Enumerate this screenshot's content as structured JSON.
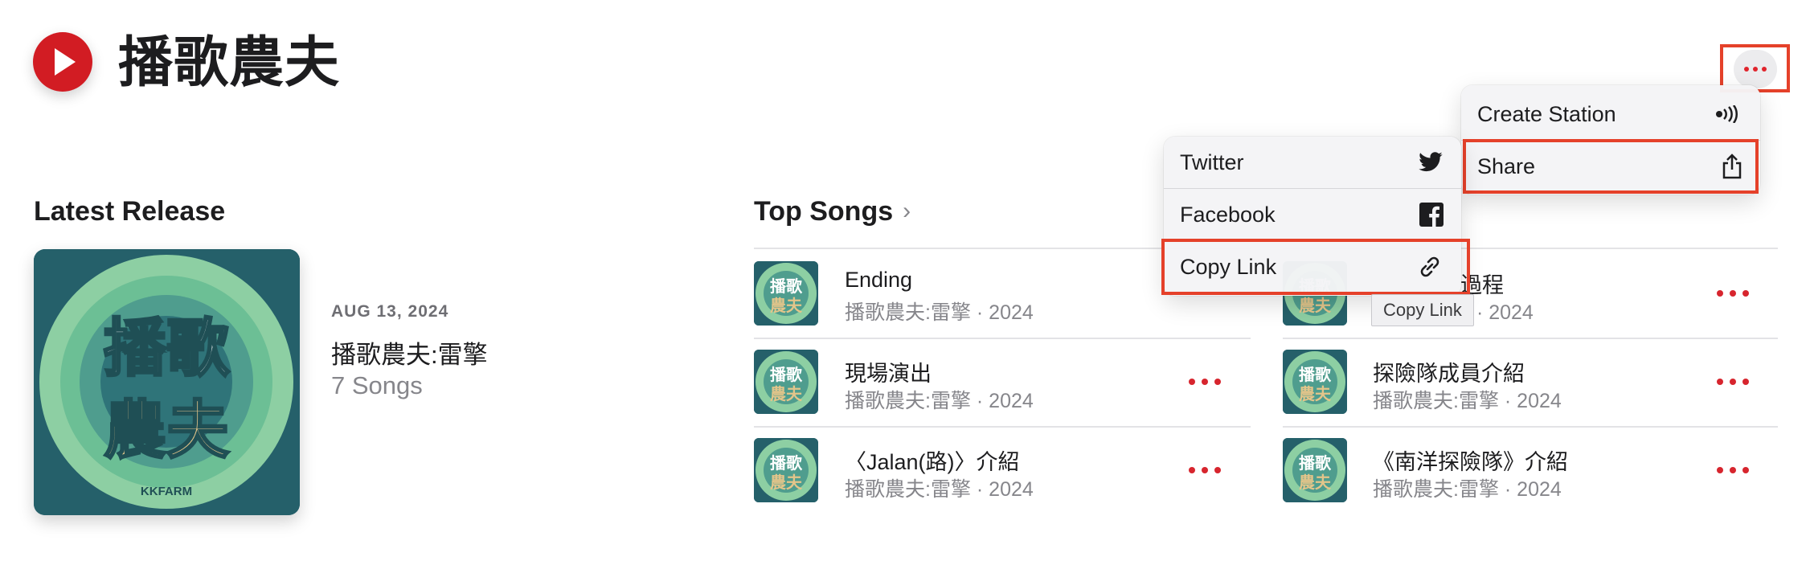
{
  "artist": {
    "name": "播歌農夫"
  },
  "latest_release": {
    "section_title": "Latest Release",
    "date": "AUG 13, 2024",
    "album": "播歌農夫:雷擎",
    "count": "7 Songs",
    "cover": {
      "line1": "播歌",
      "line2": "農夫",
      "brand": "KKFARM"
    }
  },
  "top_songs": {
    "section_title": "Top Songs",
    "chevron": "›",
    "thumb_text": {
      "line1": "播歌",
      "line2": "農夫"
    },
    "left": [
      {
        "title": "Ending",
        "subtitle": "播歌農夫:雷擎 · 2024"
      },
      {
        "title": "現場演出",
        "subtitle": "播歌農夫:雷擎 · 2024"
      },
      {
        "title": "〈Jalan(路)〉介紹",
        "subtitle": "播歌農夫:雷擎 · 2024"
      }
    ],
    "right": [
      {
        "title": "過程",
        "subtitle": "擎 · 2024"
      },
      {
        "title": "探險隊成員介紹",
        "subtitle": "播歌農夫:雷擎 · 2024"
      },
      {
        "title": "《南洋探險隊》介紹",
        "subtitle": "播歌農夫:雷擎 · 2024"
      }
    ]
  },
  "context_menu": {
    "items": [
      {
        "label": "Create Station",
        "icon": "radio-station-icon"
      },
      {
        "label": "Share",
        "icon": "share-icon"
      }
    ]
  },
  "share_menu": {
    "items": [
      {
        "label": "Twitter",
        "icon": "twitter-icon"
      },
      {
        "label": "Facebook",
        "icon": "facebook-icon"
      },
      {
        "label": "Copy Link",
        "icon": "link-icon"
      }
    ]
  },
  "tooltip": {
    "text": "Copy Link"
  },
  "colors": {
    "accent": "#d7252e",
    "highlight": "#e5412a",
    "cover_dark": "#25606a",
    "cover_ring": "#8dcfa3"
  }
}
